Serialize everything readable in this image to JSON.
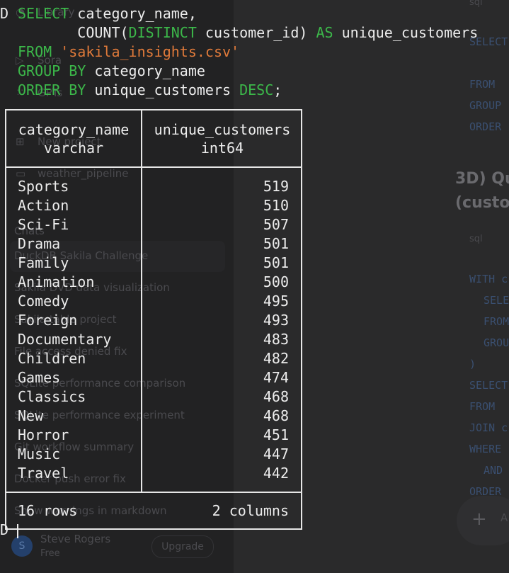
{
  "background": {
    "sidebar_items": [
      {
        "label": "Library",
        "icon": "library-icon"
      },
      {
        "label": "Sora",
        "icon": "play-circle-icon"
      },
      {
        "label": "GPTs",
        "icon": "grid-icon"
      },
      {
        "label": "New project",
        "icon": "folder-plus-icon"
      },
      {
        "label": "weather_pipeline",
        "icon": "folder-icon"
      }
    ],
    "section_label": "Chats",
    "chats": [
      "DuckDB Sakila Challenge",
      "Sakila DVD data visualization",
      "Sakila table project",
      "File access denied fix",
      "SQLite performance comparison",
      "SQLite performance experiment",
      "Git workflow summary",
      "Docker push error fix",
      "Show warnings in markdown"
    ],
    "user_name": "Steve Rogers",
    "user_plan": "Free",
    "avatar_initial": "S",
    "upgrade_label": "Upgrade",
    "main_code_label_top": "sql",
    "main_code_top": [
      "SELECT",
      "FROM",
      "GROUP",
      "ORDER"
    ],
    "main_heading_line1": "3D) Qu",
    "main_heading_line2": "(custor",
    "main_code_label_2": "sql",
    "main_code_2": [
      "WITH c",
      "SELE",
      "FROM",
      "GROU",
      ")",
      "SELECT",
      "FROM",
      "JOIN c",
      "WHERE",
      "AND",
      "ORDER"
    ],
    "ask_placeholder": "A"
  },
  "terminal": {
    "prompt": "D",
    "query_lines": [
      {
        "parts": [
          {
            "t": "SELECT",
            "c": "kw"
          },
          {
            "t": " category_name,",
            "c": ""
          }
        ]
      },
      {
        "parts": [
          {
            "t": "       COUNT(",
            "c": ""
          },
          {
            "t": "DISTINCT",
            "c": "kw"
          },
          {
            "t": " customer_id) ",
            "c": ""
          },
          {
            "t": "AS",
            "c": "kw"
          },
          {
            "t": " unique_customers",
            "c": ""
          }
        ]
      },
      {
        "parts": [
          {
            "t": "FROM",
            "c": "kw"
          },
          {
            "t": " ",
            "c": ""
          },
          {
            "t": "'sakila_insights.csv'",
            "c": "str"
          }
        ]
      },
      {
        "parts": [
          {
            "t": "GROUP BY",
            "c": "kw"
          },
          {
            "t": " category_name",
            "c": ""
          }
        ]
      },
      {
        "parts": [
          {
            "t": "ORDER BY",
            "c": "kw"
          },
          {
            "t": " unique_customers ",
            "c": ""
          },
          {
            "t": "DESC",
            "c": "kw"
          },
          {
            "t": ";",
            "c": ""
          }
        ]
      }
    ],
    "result": {
      "columns": [
        {
          "name": "category_name",
          "type": "varchar"
        },
        {
          "name": "unique_customers",
          "type": "int64"
        }
      ],
      "rows": [
        [
          "Sports",
          "519"
        ],
        [
          "Action",
          "510"
        ],
        [
          "Sci-Fi",
          "507"
        ],
        [
          "Drama",
          "501"
        ],
        [
          "Family",
          "501"
        ],
        [
          "Animation",
          "500"
        ],
        [
          "Comedy",
          "495"
        ],
        [
          "Foreign",
          "493"
        ],
        [
          "Documentary",
          "483"
        ],
        [
          "Children",
          "482"
        ],
        [
          "Games",
          "474"
        ],
        [
          "Classics",
          "468"
        ],
        [
          "New",
          "468"
        ],
        [
          "Horror",
          "451"
        ],
        [
          "Music",
          "447"
        ],
        [
          "Travel",
          "442"
        ]
      ],
      "row_count": "16 rows",
      "column_count": "2 columns"
    }
  }
}
